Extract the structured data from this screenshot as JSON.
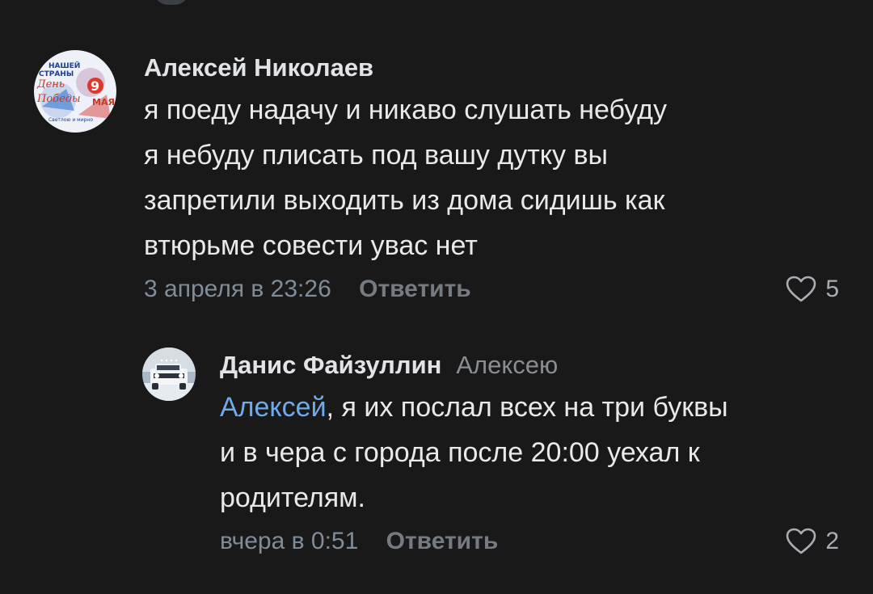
{
  "comments": [
    {
      "author": "Алексей Николаев",
      "avatar_text": [
        "НАШЕЙ",
        "СТРАНЫ",
        "День",
        "Победы",
        "9",
        "МАЯ",
        "Светлою и мирно"
      ],
      "lines": [
        "я поеду надачу и никаво слушать небуду",
        "я небуду плисать под вашу дутку вы",
        "запретили выходить из дома сидишь как",
        "втюрьме совести увас нет"
      ],
      "time": "3 апреля в 23:26",
      "reply_label": "Ответить",
      "likes": "5",
      "like_icon": "heart-outline-icon"
    },
    {
      "author": "Данис Файзуллин",
      "reply_to": "Алексею",
      "mention": "Алексей",
      "line1_rest": ", я их послал всех на три буквы",
      "lines": [
        "и в чера с города после 20:00 уехал к",
        "родителям."
      ],
      "time": "вчера в 0:51",
      "reply_label": "Ответить",
      "likes": "2",
      "like_icon": "heart-outline-icon"
    }
  ],
  "colors": {
    "background": "#19191a",
    "text": "#e8e9eb",
    "secondary": "#818c99",
    "mention": "#71aaeb"
  }
}
